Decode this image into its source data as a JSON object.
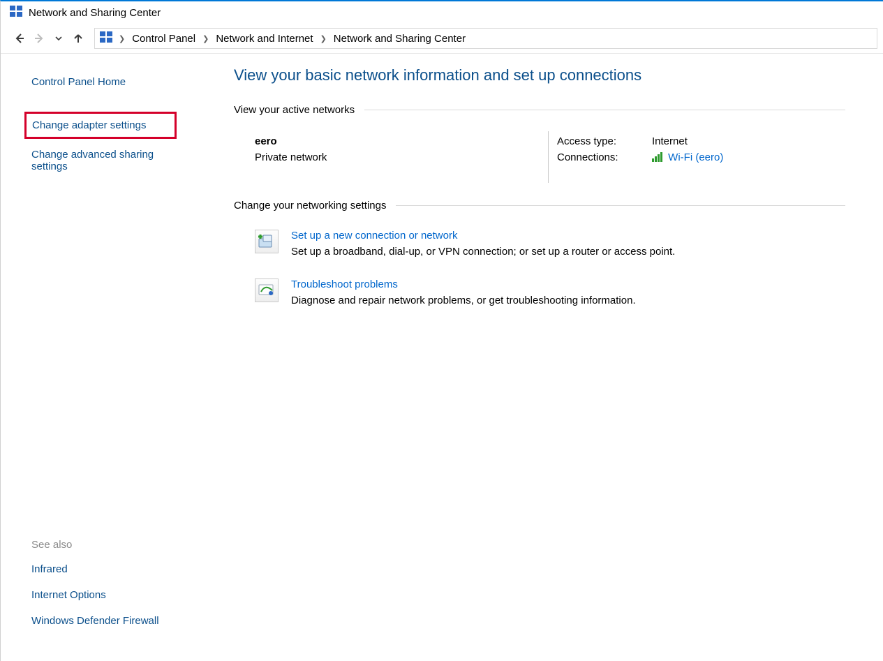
{
  "window": {
    "title": "Network and Sharing Center"
  },
  "breadcrumb": {
    "items": [
      "Control Panel",
      "Network and Internet",
      "Network and Sharing Center"
    ]
  },
  "sidebar": {
    "home": "Control Panel Home",
    "links": {
      "adapter": "Change adapter settings",
      "advanced": "Change advanced sharing settings"
    },
    "see_also": {
      "title": "See also",
      "items": [
        "Infrared",
        "Internet Options",
        "Windows Defender Firewall"
      ]
    }
  },
  "main": {
    "title": "View your basic network information and set up connections",
    "active_header": "View your active networks",
    "network": {
      "name": "eero",
      "type": "Private network",
      "access_label": "Access type:",
      "access_value": "Internet",
      "connections_label": "Connections:",
      "connection_link": "Wi-Fi (eero)"
    },
    "change_header": "Change your networking settings",
    "actions": {
      "setup": {
        "title": "Set up a new connection or network",
        "desc": "Set up a broadband, dial-up, or VPN connection; or set up a router or access point."
      },
      "trouble": {
        "title": "Troubleshoot problems",
        "desc": "Diagnose and repair network problems, or get troubleshooting information."
      }
    }
  }
}
